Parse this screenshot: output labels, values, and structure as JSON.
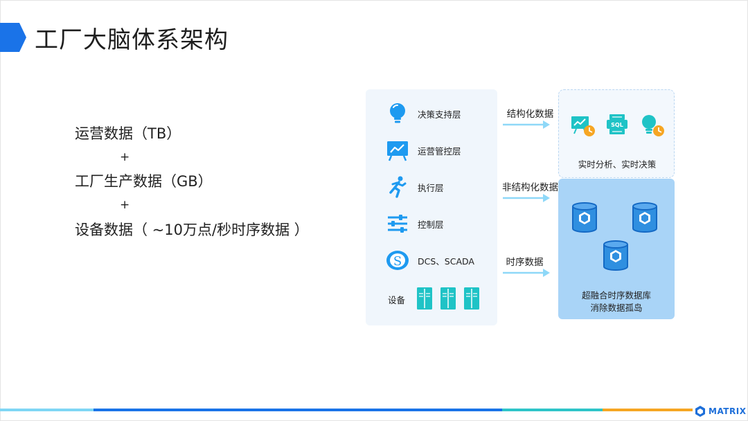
{
  "slide": {
    "title": "工厂大脑体系架构",
    "accent": "#1a73e8"
  },
  "data_sources": {
    "line1": "运营数据（TB）",
    "plus1": "+",
    "line2": "工厂生产数据（GB）",
    "plus2": "+",
    "line3": "设备数据（ ~10万点/秒时序数据 ）"
  },
  "layers": [
    {
      "label": "决策支持层",
      "icon": "lightbulb-icon"
    },
    {
      "label": "运营管控层",
      "icon": "presentation-chart-icon"
    },
    {
      "label": "执行层",
      "icon": "running-person-icon"
    },
    {
      "label": "控制层",
      "icon": "sliders-icon"
    },
    {
      "label": "DCS、SCADA",
      "icon": "scada-logo-icon"
    },
    {
      "label": "设备",
      "icon": "server-cabinet-icon"
    }
  ],
  "flows": {
    "structured": "结构化数据",
    "unstructured": "非结构化数据",
    "timeseries": "时序数据"
  },
  "outputs": {
    "realtime_label": "实时分析、实时决策",
    "db_line1": "超融合时序数据库",
    "db_line2": "消除数据孤岛"
  },
  "colors": {
    "panel_bg": "#f0f6fc",
    "icon_blue": "#1e9af0",
    "icon_teal": "#1fc3c6",
    "arrow": "#8ed8f8",
    "db_box": "#a9d4f7",
    "footer_segments": [
      "#7fd6f5",
      "#1a73e8",
      "#2ec4c8",
      "#f6a623"
    ]
  },
  "footer": {
    "brand": "MATRIX"
  }
}
